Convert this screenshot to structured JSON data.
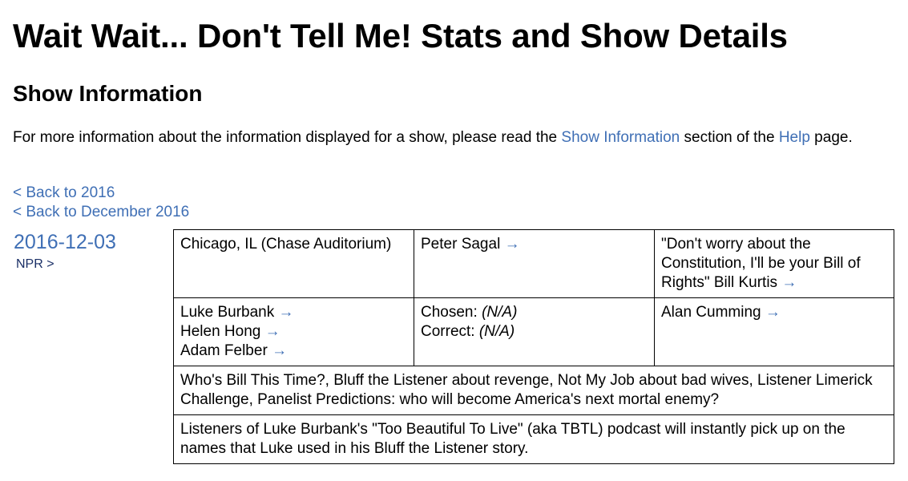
{
  "page_title": "Wait Wait... Don't Tell Me! Stats and Show Details",
  "section_title": "Show Information",
  "intro": {
    "text_before": "For more information about the information displayed for a show, please read the ",
    "link_show_info": "Show Information",
    "text_middle": " section of the ",
    "link_help": "Help",
    "text_after": " page."
  },
  "back_links": {
    "year": "< Back to 2016",
    "month": "< Back to December 2016"
  },
  "show": {
    "date": "2016-12-03",
    "network": "NPR >",
    "location": "Chicago, IL (Chase Auditorium)",
    "host": "Peter Sagal",
    "scorekeeper_quote": "\"Don't worry about the Constitution, I'll be your Bill of Rights\" Bill Kurtis",
    "panelists": [
      "Luke Burbank",
      "Helen Hong",
      "Adam Felber"
    ],
    "bluff": {
      "chosen_label": "Chosen:",
      "chosen_value": "(N/A)",
      "correct_label": "Correct:",
      "correct_value": "(N/A)"
    },
    "guest": "Alan Cumming",
    "segments": "Who's Bill This Time?, Bluff the Listener about revenge, Not My Job about bad wives, Listener Limerick Challenge, Panelist Predictions: who will become America's next mortal enemy?",
    "notes": "Listeners of Luke Burbank's \"Too Beautiful To Live\" (aka TBTL) podcast will instantly pick up on the names that Luke used in his Bluff the Listener story."
  },
  "arrow_glyph": "→",
  "colors": {
    "link": "#3f6fb5",
    "network": "#1a2f66",
    "text": "#000000"
  }
}
